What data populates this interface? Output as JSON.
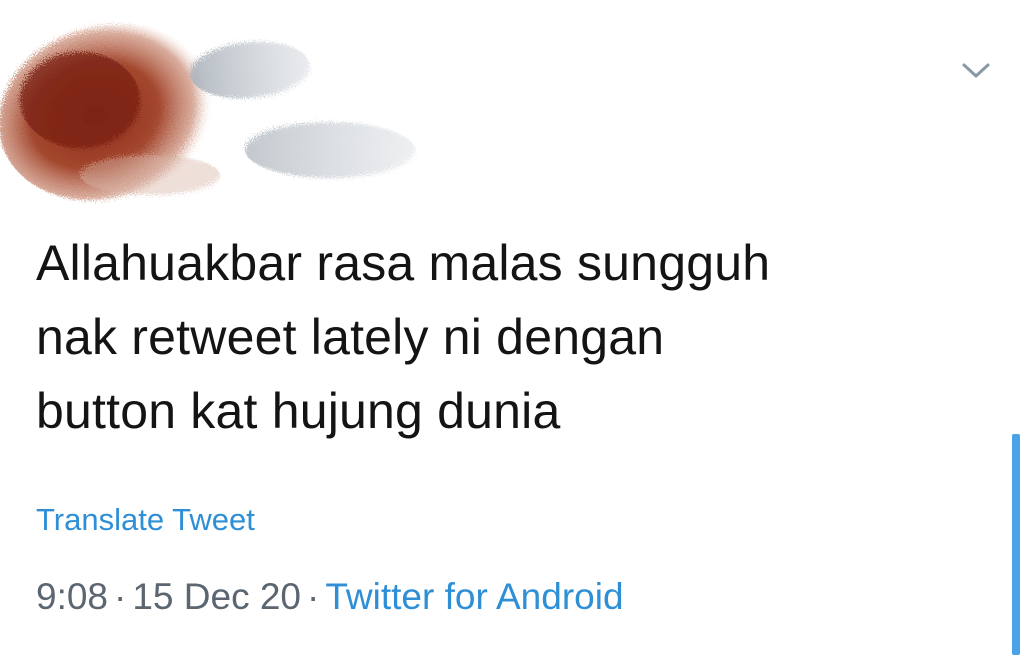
{
  "tweet": {
    "text": "Allahuakbar rasa malas sungguh\nnak retweet lately ni dengan\nbutton kat hujung dunia",
    "translate_label": "Translate Tweet",
    "time": "9:08",
    "date": "15 Dec 20",
    "separator": "·",
    "source": "Twitter for Android"
  },
  "icons": {
    "menu": "chevron-down-icon"
  },
  "colors": {
    "link": "#2f8fd6",
    "text": "#141414",
    "meta": "#5b6670",
    "scroll_indicator": "#4aa3e6"
  }
}
